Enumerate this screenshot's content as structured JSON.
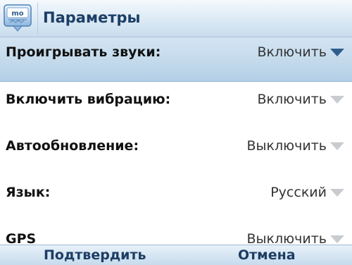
{
  "header": {
    "title": "Параметры",
    "app_icon_text": "mo"
  },
  "settings": [
    {
      "label": "Проигрывать звуки:",
      "value": "Включить",
      "selected": true
    },
    {
      "label": "Включить вибрацию:",
      "value": "Включить",
      "selected": false
    },
    {
      "label": "Автообновление:",
      "value": "Выключить",
      "selected": false
    },
    {
      "label": "Язык:",
      "value": "Русский",
      "selected": false
    },
    {
      "label": "GPS",
      "value": "Выключить",
      "selected": false
    }
  ],
  "softkeys": {
    "left": "Подтвердить",
    "right": "Отмена"
  },
  "colors": {
    "accent": "#1c3f66",
    "selection": "#c3daec",
    "arrow_active": "#2f5d8c",
    "arrow_inactive": "#c8ccd0"
  },
  "icons": [
    "app-icon",
    "dropdown-arrow-icon"
  ]
}
